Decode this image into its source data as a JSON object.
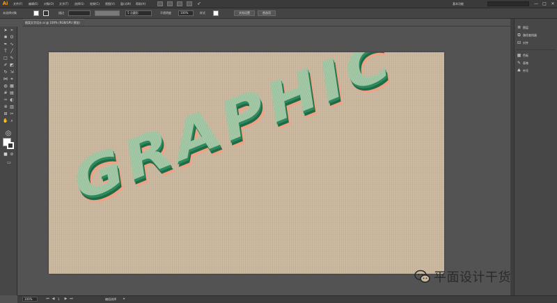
{
  "menubar": {
    "logo": "Ai",
    "items": [
      "文件(F)",
      "编辑(E)",
      "对象(O)",
      "文字(T)",
      "选择(S)",
      "效果(C)",
      "视图(V)",
      "窗口(W)",
      "帮助(H)"
    ],
    "workspace": "基本功能",
    "window_controls": [
      "—",
      "□",
      "✕"
    ]
  },
  "controlbar": {
    "selection": "未选择对象",
    "stroke_label": "描边",
    "opacity_label": "不透明度",
    "style_label": "样式",
    "brush_value": "5 点圆形",
    "opacity_value": "100%",
    "doc_setup": "文档设置",
    "preferences": "首选项"
  },
  "document": {
    "tab_title": "图案文字设计.ai @ 100% (RGB/GPU 预览)",
    "artwork_text": "GRAPHIC",
    "colors": {
      "board": "#cab79e",
      "face": "#9cc39f",
      "dark": "#1f6b48",
      "mid": "#2e8a5c",
      "salmon": "#f0a286"
    }
  },
  "right_panel": {
    "groups": [
      [
        {
          "icon": "stack-icon",
          "label": "图层"
        },
        {
          "icon": "link-icon",
          "label": "路径查找器"
        },
        {
          "icon": "align-icon",
          "label": "对齐"
        }
      ],
      [
        {
          "icon": "swatch-icon",
          "label": "色板"
        },
        {
          "icon": "brush-icon",
          "label": "画笔"
        },
        {
          "icon": "symbol-icon",
          "label": "符号"
        }
      ]
    ]
  },
  "statusbar": {
    "zoom": "100%",
    "page": "1",
    "tool_name": "编组选择"
  },
  "watermark": {
    "text": "平面设计干货教程"
  }
}
